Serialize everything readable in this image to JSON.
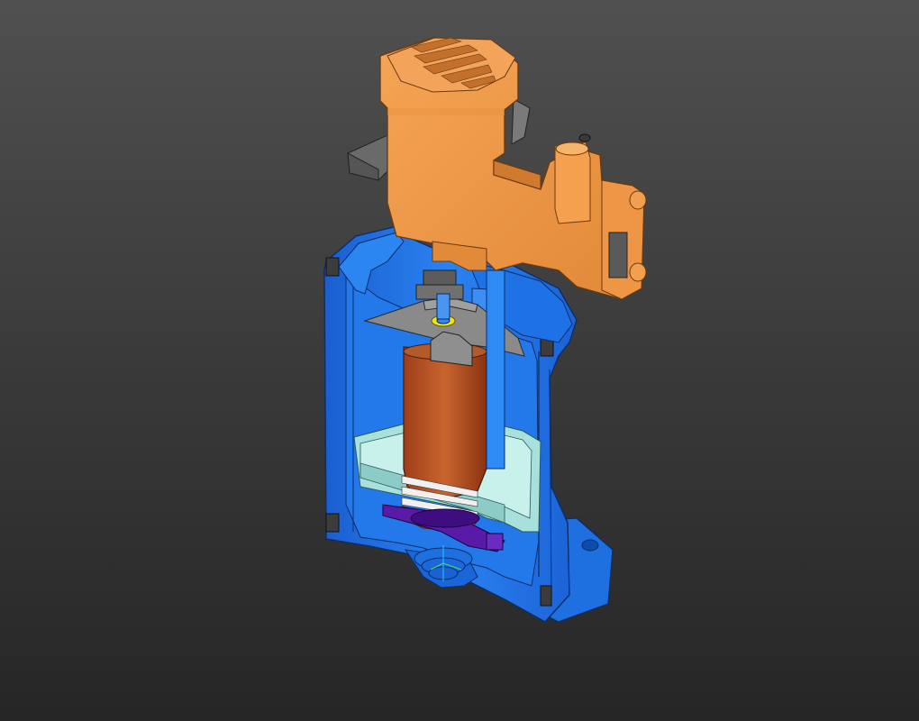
{
  "scene": {
    "view": "3D section view",
    "parts": [
      {
        "name": "actuator-housing",
        "color": "#F09A4A"
      },
      {
        "name": "valve-body",
        "color": "#1E6FE0"
      },
      {
        "name": "liner-sleeve",
        "color": "#B9532A"
      },
      {
        "name": "float-cup",
        "color": "#A8E0DC"
      },
      {
        "name": "seat-gasket",
        "color": "#5A1AA8"
      },
      {
        "name": "deflector-plate",
        "color": "#8A8A8A"
      },
      {
        "name": "handle-lever",
        "color": "#6A6A6A"
      },
      {
        "name": "spring-ring",
        "color": "#F1E31A"
      }
    ],
    "triad": {
      "x_color": "#40E070",
      "y_color": "#1EC8FF"
    }
  }
}
